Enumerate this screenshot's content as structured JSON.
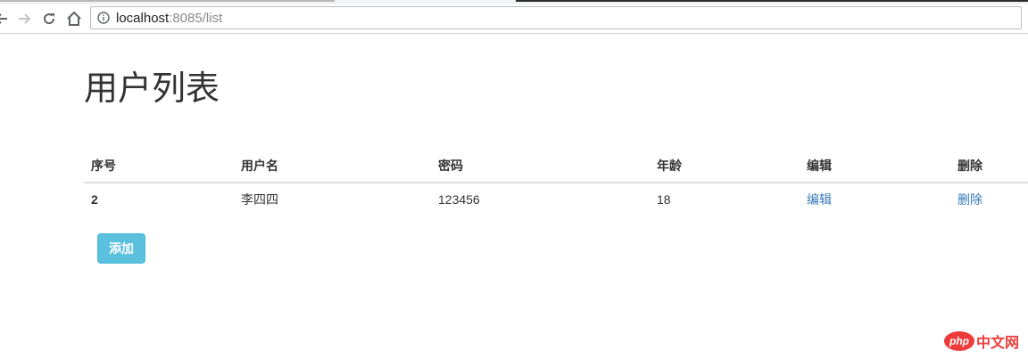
{
  "browser": {
    "url_host": "localhost",
    "url_rest": ":8085/list"
  },
  "page": {
    "title": "用户列表"
  },
  "table": {
    "headers": [
      "序号",
      "用户名",
      "密码",
      "年龄",
      "编辑",
      "删除"
    ],
    "rows": [
      {
        "id": "2",
        "username": "李四四",
        "password": "123456",
        "age": "18",
        "edit": "编辑",
        "delete": "删除"
      }
    ]
  },
  "actions": {
    "add_label": "添加"
  },
  "watermark": {
    "logo_text": "php",
    "site_text": "中文网"
  },
  "colors": {
    "link": "#337ab7",
    "info_button": "#5bc0de",
    "watermark": "#ed3b3b"
  }
}
